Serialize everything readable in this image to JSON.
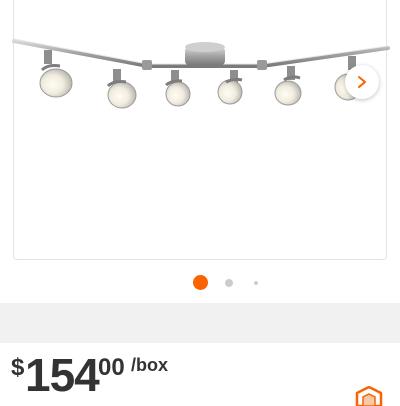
{
  "carousel": {
    "next_icon": "chevron-right-icon",
    "image_count": 3,
    "active_index": 0,
    "colors": {
      "active_dot": "#f96302",
      "inactive_dot": "#cccccc"
    }
  },
  "price": {
    "currency": "$",
    "dollars": "154",
    "cents": "00",
    "unit": "/box",
    "color": "#333333"
  },
  "badge": {
    "icon": "orange-hexagon-badge-icon",
    "color": "#f96302"
  }
}
